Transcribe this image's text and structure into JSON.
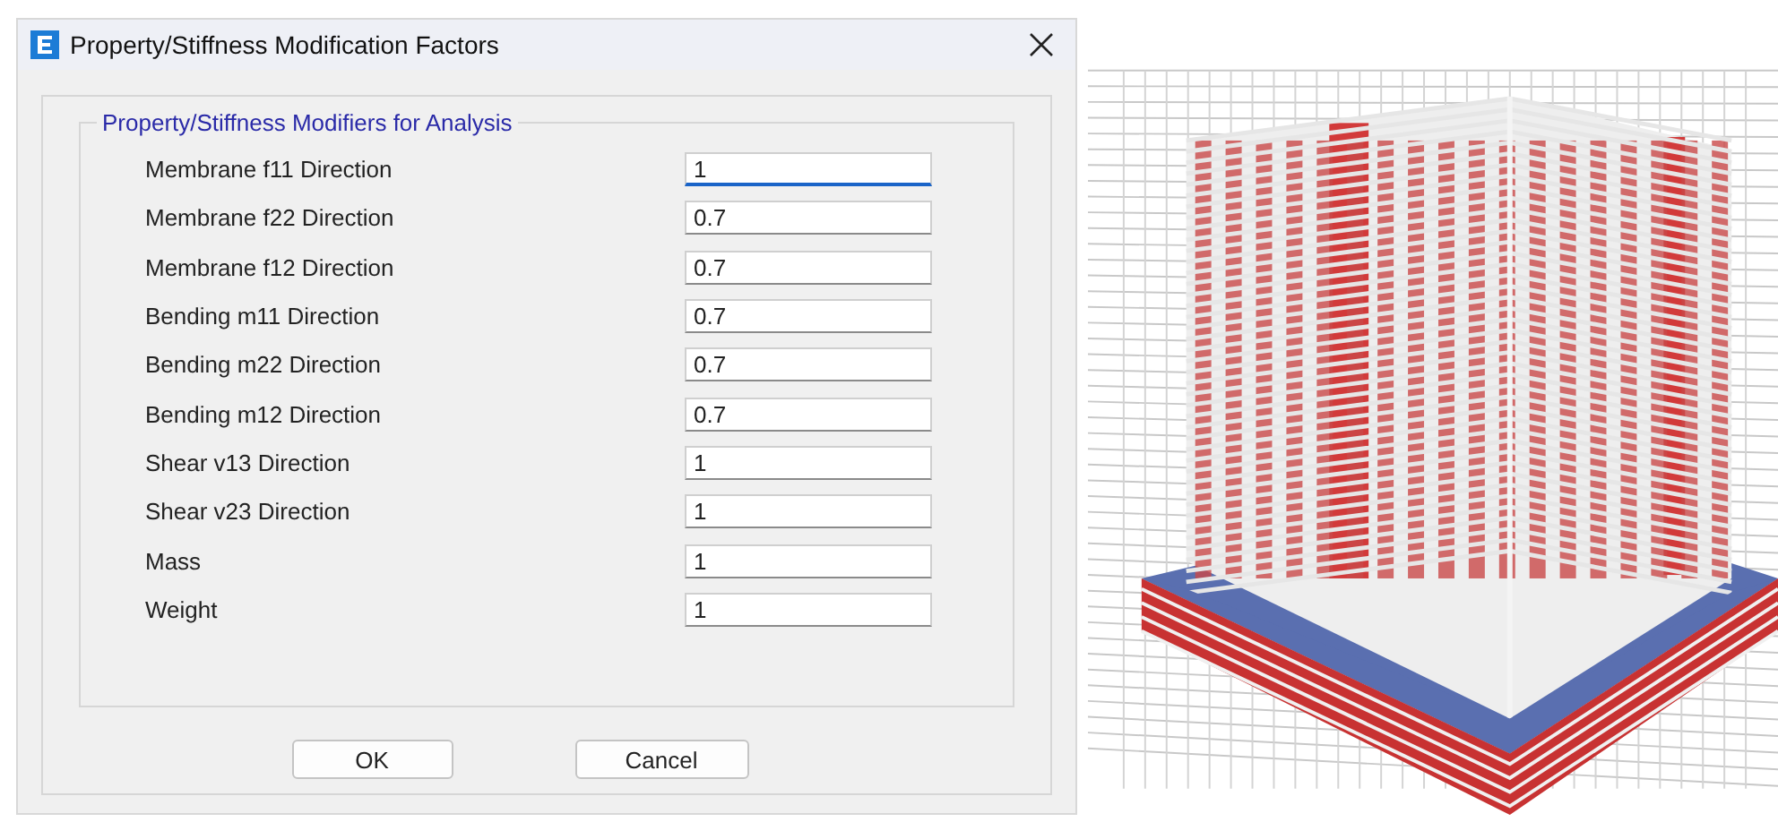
{
  "dialog": {
    "title": "Property/Stiffness Modification Factors",
    "group_title": "Property/Stiffness Modifiers for Analysis",
    "fields": [
      {
        "label": "Membrane f11 Direction",
        "value": "1",
        "focused": true
      },
      {
        "label": "Membrane f22 Direction",
        "value": "0.7",
        "focused": false
      },
      {
        "label": "Membrane f12 Direction",
        "value": "0.7",
        "focused": false
      },
      {
        "label": "Bending m11 Direction",
        "value": "0.7",
        "focused": false
      },
      {
        "label": "Bending m22 Direction",
        "value": "0.7",
        "focused": false
      },
      {
        "label": "Bending m12 Direction",
        "value": "0.7",
        "focused": false
      },
      {
        "label": "Shear v13 Direction",
        "value": "1",
        "focused": false
      },
      {
        "label": "Shear v23 Direction",
        "value": "1",
        "focused": false
      },
      {
        "label": "Mass",
        "value": "1",
        "focused": false
      },
      {
        "label": "Weight",
        "value": "1",
        "focused": false
      }
    ],
    "buttons": [
      "OK",
      "Cancel"
    ]
  }
}
